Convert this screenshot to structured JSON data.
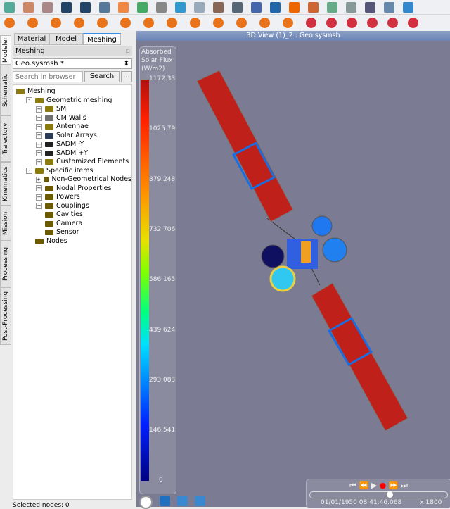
{
  "toolbar": {
    "row1_icons": [
      "new-file",
      "open-folder",
      "close-file",
      "save",
      "save-as",
      "save-all",
      "undo",
      "redo",
      "trash",
      "cut",
      "copy",
      "paste",
      "paste-special",
      "edit",
      "variable",
      "paint",
      "tools",
      "graph-add",
      "graph",
      "layout",
      "export",
      "help"
    ],
    "row2_icons": [
      "triangle",
      "rectangle",
      "disc",
      "quadrangle",
      "trapezoid",
      "box",
      "cone",
      "cylinder",
      "sphere",
      "polyhedron",
      "paraboloid",
      "cup",
      "ellipsoid",
      "mesh-a",
      "mesh-b",
      "line-a",
      "line-b",
      "line-c",
      "target"
    ]
  },
  "side_tabs": [
    "Modeler",
    "Schematic",
    "Trajectory",
    "Kinematics",
    "Mission",
    "Processing",
    "Post-Processing"
  ],
  "panel": {
    "tabs": [
      "Material",
      "Model",
      "Meshing"
    ],
    "active_tab": "Meshing",
    "title": "Meshing",
    "model_select": "Geo.sysmsh *",
    "search_placeholder": "Search in browser",
    "search_button": "Search",
    "more_button": "...",
    "status": "Selected nodes: 0"
  },
  "tree": [
    {
      "label": "Meshing",
      "level": 0,
      "color": "#8a7a10"
    },
    {
      "label": "Geometric meshing",
      "level": 1,
      "color": "#8a7a10",
      "exp": "-"
    },
    {
      "label": "SM",
      "level": 2,
      "color": "#8a7a10",
      "exp": "+"
    },
    {
      "label": "CM Walls",
      "level": 2,
      "color": "#707070",
      "exp": "+"
    },
    {
      "label": "Antennae",
      "level": 2,
      "color": "#8a7a10",
      "exp": "+"
    },
    {
      "label": "Solar Arrays",
      "level": 2,
      "color": "#2a3b55",
      "exp": "+"
    },
    {
      "label": "SADM -Y",
      "level": 2,
      "color": "#222222",
      "exp": "+"
    },
    {
      "label": "SADM +Y",
      "level": 2,
      "color": "#222222",
      "exp": "+"
    },
    {
      "label": "Customized Elements",
      "level": 2,
      "color": "#8a7a10",
      "exp": "+"
    },
    {
      "label": "Specific items",
      "level": 1,
      "color": "#8a7a10",
      "exp": "-"
    },
    {
      "label": "Non-Geometrical Nodes",
      "level": 2,
      "color": "#6b5a00",
      "exp": "+"
    },
    {
      "label": "Nodal Properties",
      "level": 2,
      "color": "#6b5a00",
      "exp": "+"
    },
    {
      "label": "Powers",
      "level": 2,
      "color": "#6b5a00",
      "exp": "+"
    },
    {
      "label": "Couplings",
      "level": 2,
      "color": "#6b5a00",
      "exp": "+"
    },
    {
      "label": "Cavities",
      "level": 2,
      "color": "#6b5a00"
    },
    {
      "label": "Camera",
      "level": 2,
      "color": "#6b5a00"
    },
    {
      "label": "Sensor",
      "level": 2,
      "color": "#6b5a00"
    },
    {
      "label": "Nodes",
      "level": 1,
      "color": "#6b5a00"
    }
  ],
  "view": {
    "title": "3D View (1)_2 : Geo.sysmsh",
    "background": "#7b7b93",
    "legend": {
      "title": [
        "Absorbed",
        "Solar Flux",
        "(W/m2)"
      ],
      "ticks": [
        "1172.33",
        "1025.79",
        "879.248",
        "732.706",
        "586.165",
        "439.624",
        "293.083",
        "146.541",
        "0"
      ]
    },
    "playback": {
      "datetime": "01/01/1950 08:41:46.068",
      "speed": "x 1800",
      "slider_position": 0.56
    },
    "bottom_icons": [
      "compass",
      "settings",
      "fit-view",
      "lock-view"
    ]
  }
}
